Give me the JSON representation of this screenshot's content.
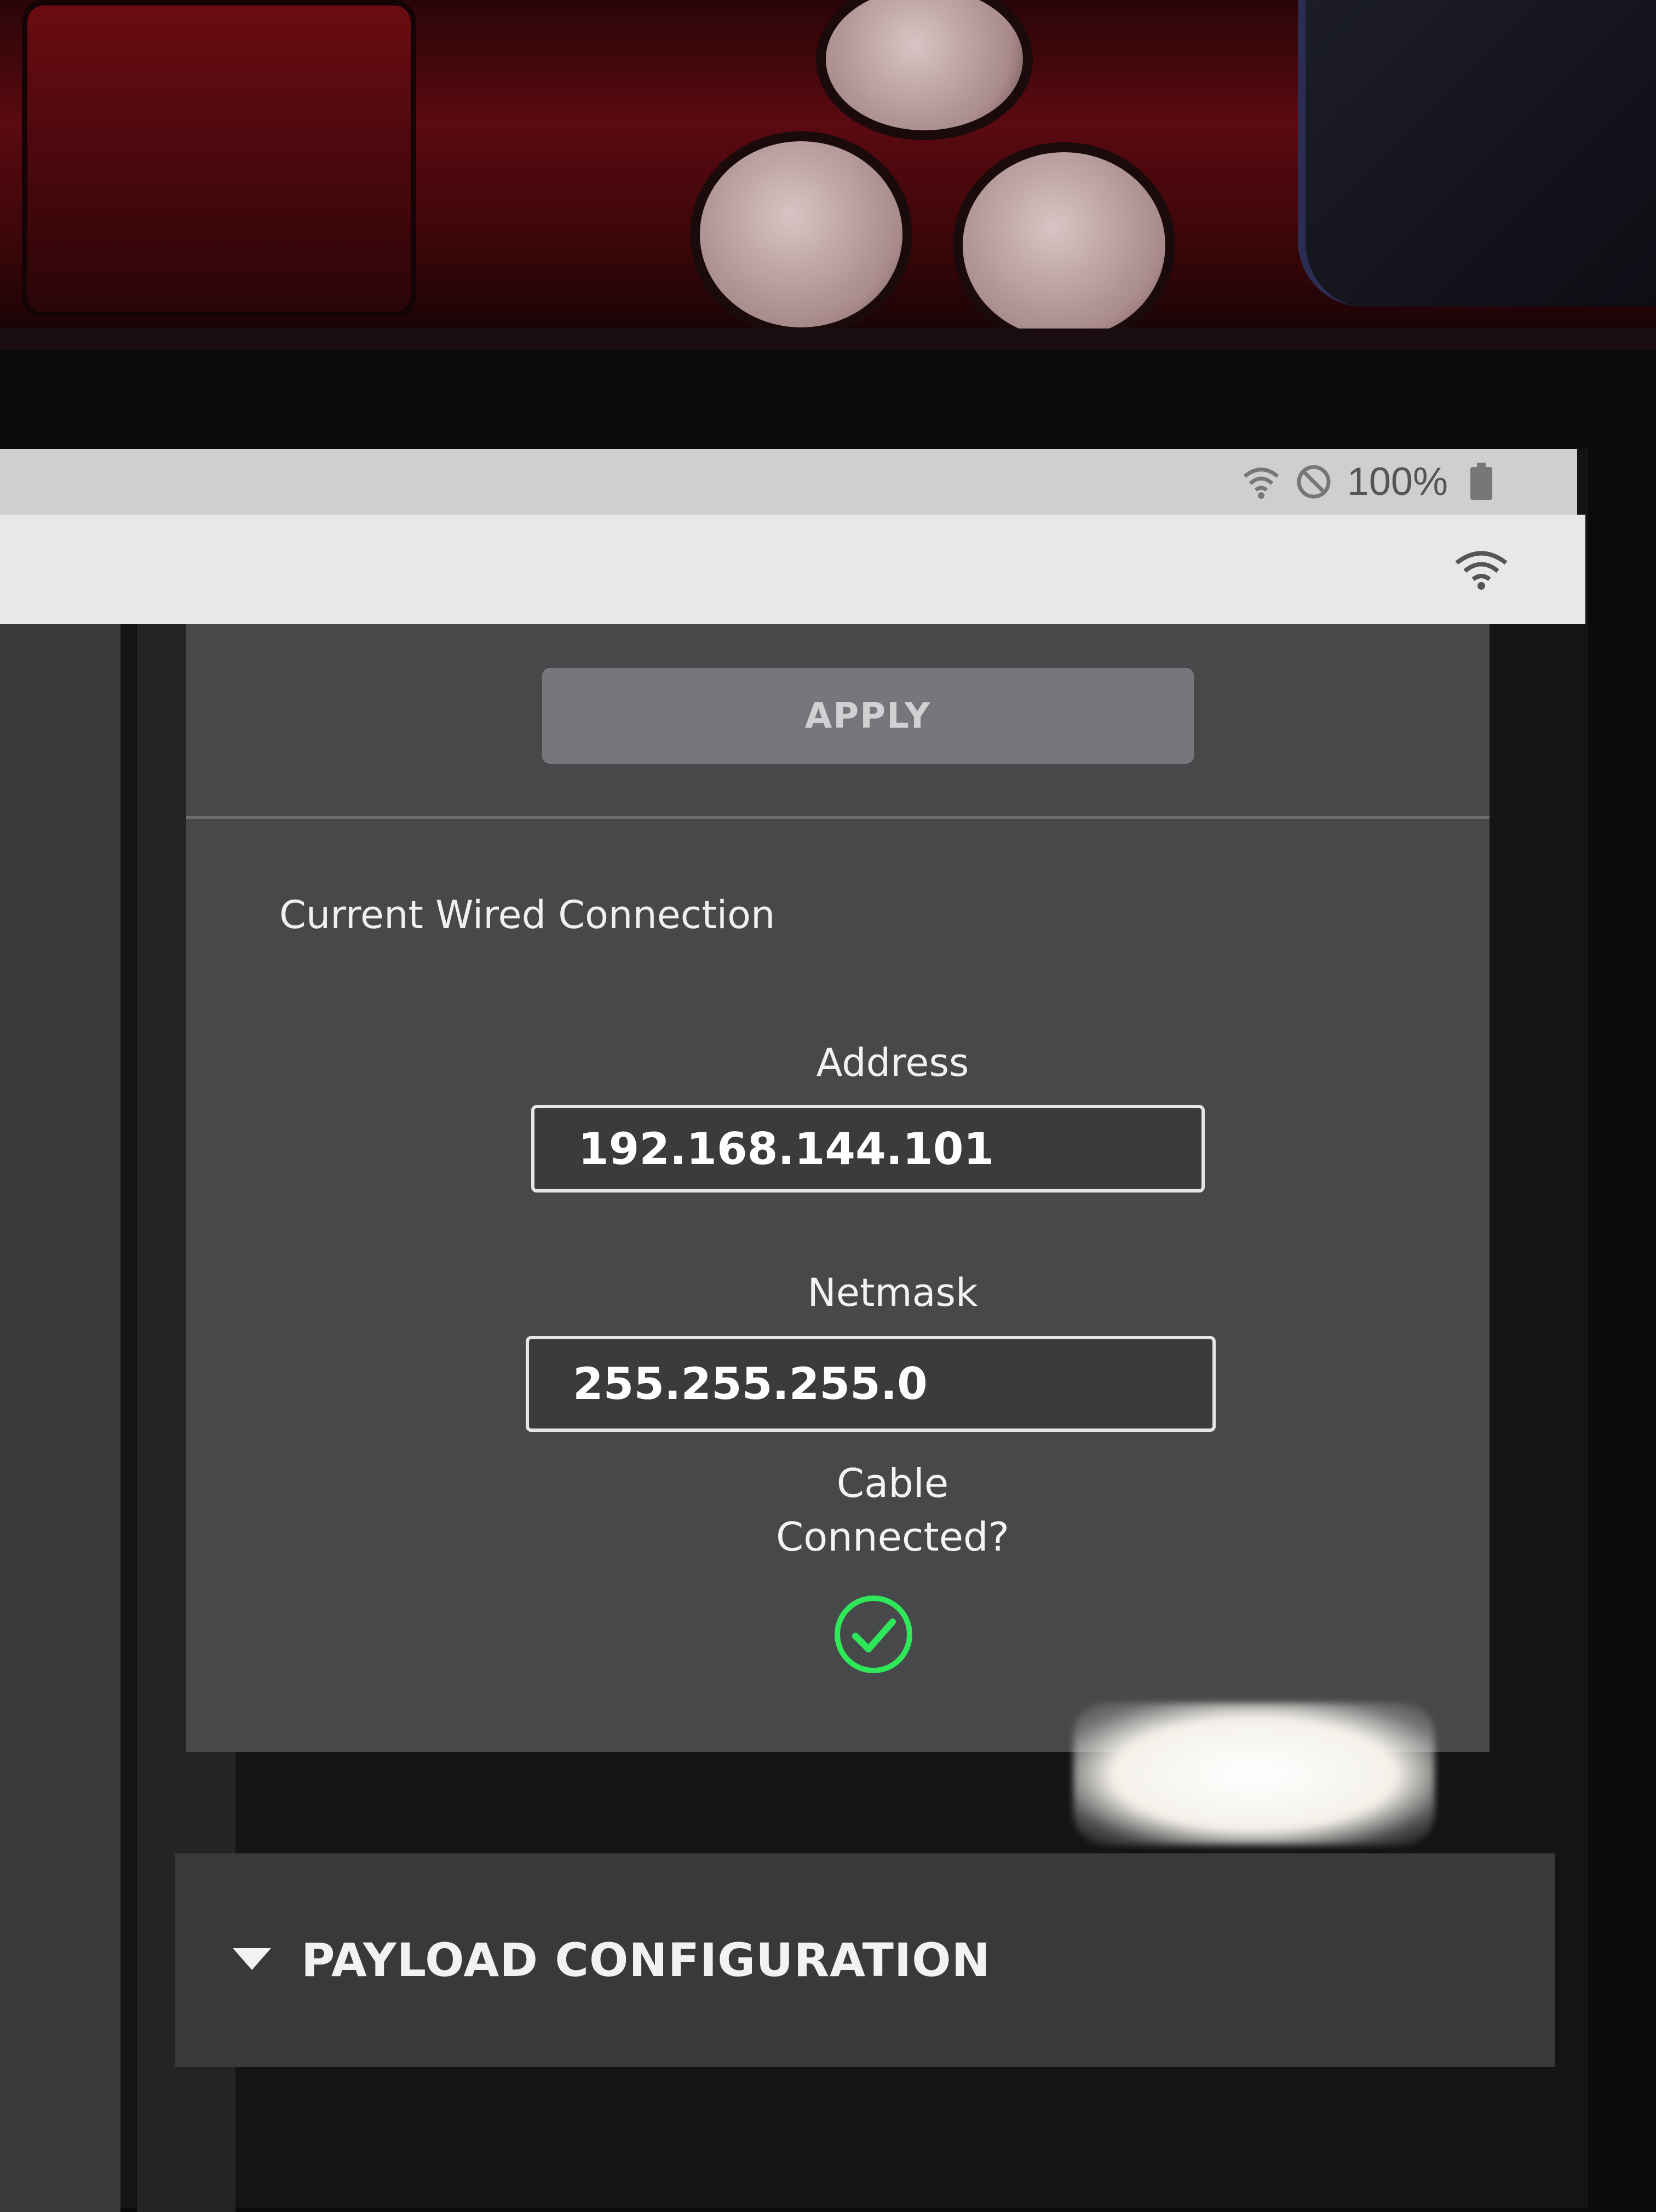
{
  "status_bar": {
    "battery_percent": "100%",
    "icons": [
      "wifi-signal-icon",
      "do-not-disturb-icon",
      "battery-icon"
    ]
  },
  "title_bar": {
    "icons": [
      "wifi-icon"
    ]
  },
  "panel": {
    "apply_label": "APPLY",
    "section_title": "Current Wired Connection",
    "address": {
      "label": "Address",
      "value": "192.168.144.101"
    },
    "netmask": {
      "label": "Netmask",
      "value": "255.255.255.0"
    },
    "cable": {
      "label_line1": "Cable",
      "label_line2": "Connected?",
      "status_icon": "check-circle-icon",
      "status_color": "#2ee85a"
    }
  },
  "payload_section": {
    "label": "PAYLOAD CONFIGURATION",
    "icon": "triangle-down-icon"
  },
  "colors": {
    "panel_bg": "#47484a",
    "apply_bg": "#75777a",
    "status_bar_bg": "#cfcfcf",
    "title_bar_bg": "#e8e8e8"
  }
}
